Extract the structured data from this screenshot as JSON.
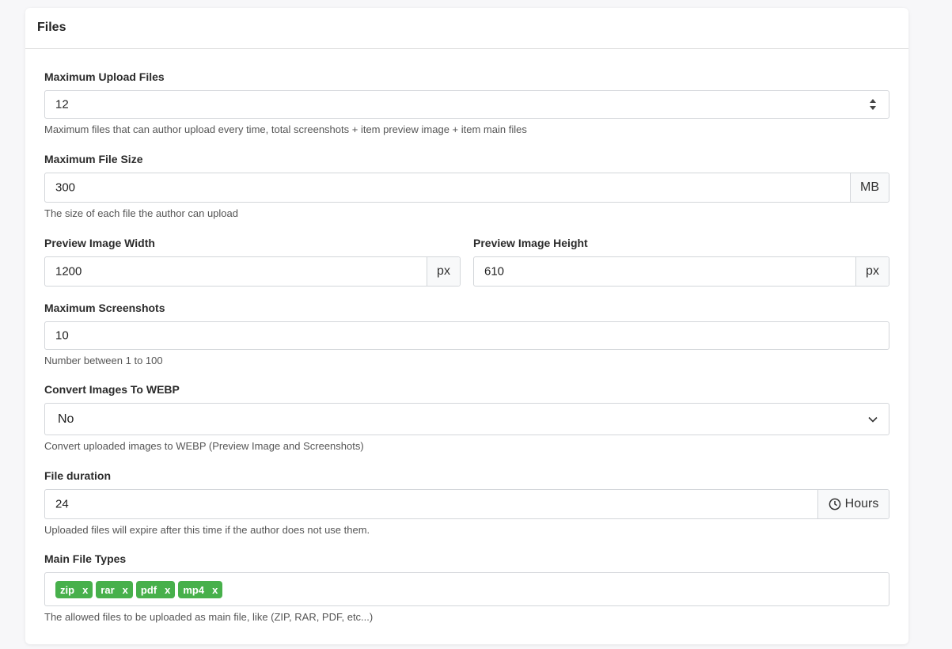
{
  "card": {
    "title": "Files"
  },
  "max_upload": {
    "label": "Maximum Upload Files",
    "value": "12",
    "help": "Maximum files that can author upload every time, total screenshots + item preview image + item main files"
  },
  "max_size": {
    "label": "Maximum File Size",
    "value": "300",
    "unit": "MB",
    "help": "The size of each file the author can upload"
  },
  "preview_width": {
    "label": "Preview Image Width",
    "value": "1200",
    "unit": "px"
  },
  "preview_height": {
    "label": "Preview Image Height",
    "value": "610",
    "unit": "px"
  },
  "max_screenshots": {
    "label": "Maximum Screenshots",
    "value": "10",
    "help": "Number between 1 to 100"
  },
  "webp": {
    "label": "Convert Images To WEBP",
    "selected": "No",
    "help": "Convert uploaded images to WEBP (Preview Image and Screenshots)"
  },
  "duration": {
    "label": "File duration",
    "value": "24",
    "unit": "Hours",
    "help": "Uploaded files will expire after this time if the author does not use them."
  },
  "file_types": {
    "label": "Main File Types",
    "tags": [
      "zip",
      "rar",
      "pdf",
      "mp4"
    ],
    "remove": "x",
    "help": "The allowed files to be uploaded as main file, like (ZIP, RAR, PDF, etc...)"
  },
  "colors": {
    "tag": "#47b04b",
    "border": "#d3d6da"
  },
  "icons": {
    "spinner": "up-down-icon",
    "dropdown": "chevron-down-icon",
    "clock": "clock-icon"
  }
}
